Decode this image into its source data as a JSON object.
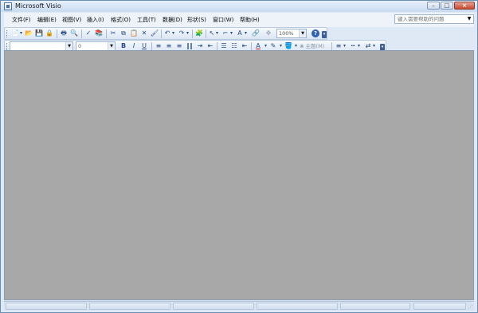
{
  "window": {
    "title": "Microsoft Visio"
  },
  "window_controls": {
    "minimize_glyph": "–",
    "maximize_glyph": "□",
    "close_glyph": "×"
  },
  "menu": [
    {
      "name": "menu-file",
      "label": "文件(F)"
    },
    {
      "name": "menu-edit",
      "label": "编辑(E)"
    },
    {
      "name": "menu-view",
      "label": "视图(V)"
    },
    {
      "name": "menu-insert",
      "label": "插入(I)"
    },
    {
      "name": "menu-format",
      "label": "格式(O)"
    },
    {
      "name": "menu-tools",
      "label": "工具(T)"
    },
    {
      "name": "menu-data",
      "label": "数据(D)"
    },
    {
      "name": "menu-shape",
      "label": "形状(S)"
    },
    {
      "name": "menu-window",
      "label": "窗口(W)"
    },
    {
      "name": "menu-help",
      "label": "帮助(H)"
    }
  ],
  "help_search": {
    "placeholder": "键入需要帮助的问题"
  },
  "standard_toolbar": {
    "zoom_value": "100%",
    "icons": {
      "new": "📄",
      "dropdown": "▾",
      "open": "📂",
      "save": "💾",
      "permission": "🔒",
      "print": "🖶",
      "print_preview": "🔍",
      "spelling": "✓",
      "research": "📚",
      "cut": "✂",
      "copy": "⧉",
      "paste": "📋",
      "delete": "✕",
      "format_painter": "🖌",
      "undo": "↶",
      "redo": "↷",
      "shapes": "🧩",
      "pointer": "↖",
      "connector": "⌐",
      "text": "A",
      "hyperlink": "🔗",
      "pan_zoom": "✥",
      "help": "?"
    }
  },
  "formatting_toolbar": {
    "font_value": "",
    "size_value": "0",
    "theme_label": "主题(M)",
    "icons": {
      "bold": "B",
      "italic": "I",
      "underline": "U",
      "align_left": "≡",
      "align_center": "≡",
      "align_right": "≡",
      "justify": "‖‖",
      "increase_indent": "⇥",
      "decrease_indent": "⇤",
      "bullets": "☰",
      "numbering": "☷",
      "outdent": "⇤",
      "font_color": "A",
      "line_color": "✎",
      "fill_color": "🪣",
      "line_weight": "≡",
      "line_pattern": "┅",
      "line_ends": "⇄",
      "theme_icon": "❀"
    }
  },
  "colors": {
    "canvas": "#a8a8a8",
    "title_bar": "#c9dbf0",
    "close_button": "#c8472f",
    "toolbar": "#dbe6f3"
  }
}
